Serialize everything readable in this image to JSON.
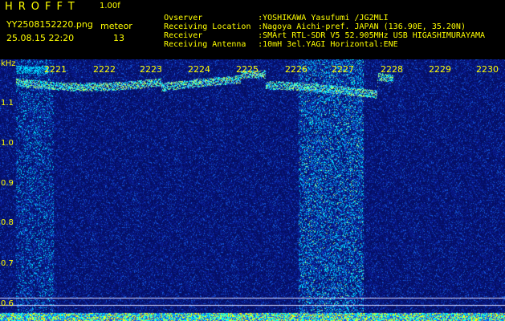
{
  "header": {
    "app_name": "HROFFT",
    "version": "1.00f",
    "filename": "YY2508152220.png",
    "meteor_label": "meteor",
    "datetime": "25.08.15 22:20",
    "meteor_count": "13"
  },
  "station_info": [
    {
      "key": "Ovserver",
      "value": ":YOSHIKAWA Yasufumi /JG2MLI"
    },
    {
      "key": "Receiving Location",
      "value": ":Nagoya Aichi-pref. JAPAN (136.90E, 35.20N)"
    },
    {
      "key": "Receiver",
      "value": ":SMArt RTL-SDR V5 52.905MHz USB HIGASHIMURAYAMA"
    },
    {
      "key": "Receiving Antenna",
      "value": ":10mH 3el.YAGI Horizontal:ENE"
    }
  ],
  "plot": {
    "unit_label": "kHz",
    "time_labels": [
      "2221",
      "2222",
      "2223",
      "2224",
      "2225",
      "2226",
      "2227",
      "2228",
      "2229",
      "2230"
    ],
    "freq_labels": [
      "1.1",
      "1.0",
      "0.9",
      "0.8",
      "0.7",
      "0.6"
    ],
    "colors": {
      "text": "#ffff00",
      "background": "#000000",
      "noise_base": "#0a1a70",
      "signal": "#00ffff"
    }
  }
}
